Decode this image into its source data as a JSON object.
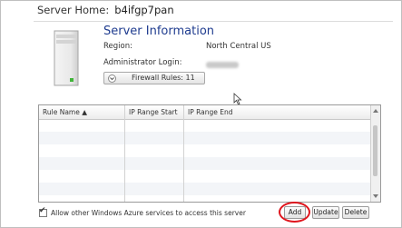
{
  "header": {
    "label": "Server Home:",
    "server_name": "b4ifgp7pan"
  },
  "server_info": {
    "title": "Server Information",
    "region_label": "Region:",
    "region_value": "North Central US",
    "admin_label": "Administrator Login:",
    "admin_value": "",
    "firewall_button": "Firewall Rules: 11"
  },
  "grid": {
    "columns": [
      "Rule Name ▲",
      "IP Range Start",
      "IP Range End"
    ]
  },
  "footer": {
    "allow_azure_checked": true,
    "allow_azure_label": "Allow other Windows Azure services to access this server",
    "add_label": "Add",
    "update_label": "Update",
    "delete_label": "Delete"
  },
  "colors": {
    "title": "#1f3c8f",
    "highlight": "#e0151d",
    "alt_row": "#f3f5f8"
  }
}
